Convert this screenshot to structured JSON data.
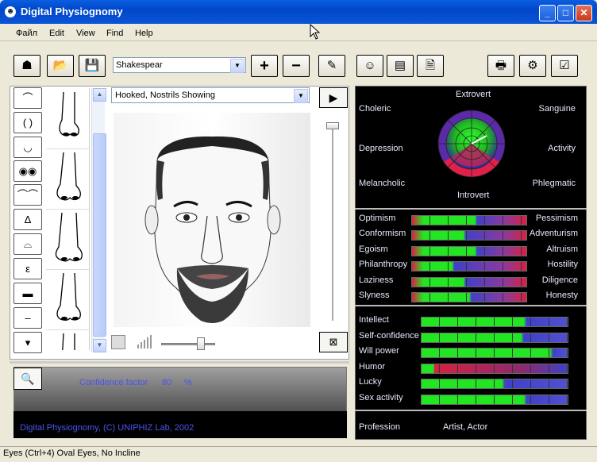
{
  "window": {
    "title": "Digital Physiognomy"
  },
  "menu": [
    "Файл",
    "Edit",
    "View",
    "Find",
    "Help"
  ],
  "toolbar": {
    "preset": "Shakespear"
  },
  "nose_panel": {
    "selected": "Hooked, Nostrils Showing"
  },
  "confidence": {
    "label": "Confidence factor",
    "value": "80",
    "unit": "%"
  },
  "copyright": "Digital Physiognomy, (C) UNIPHIZ Lab, 2002",
  "temperament": {
    "top": "Extrovert",
    "bottom": "Introvert",
    "left": [
      "Choleric",
      "Depression",
      "Melancholic"
    ],
    "right": [
      "Sanguine",
      "Activity",
      "Phlegmatic"
    ]
  },
  "traits": [
    {
      "left": "Optimism",
      "right": "Pessimism",
      "value": 0.55
    },
    {
      "left": "Conformism",
      "right": "Adventurism",
      "value": 0.45
    },
    {
      "left": "Egoism",
      "right": "Altruism",
      "value": 0.55
    },
    {
      "left": "Philanthropy",
      "right": "Hostility",
      "value": 0.35
    },
    {
      "left": "Laziness",
      "right": "Diligence",
      "value": 0.45
    },
    {
      "left": "Slyness",
      "right": "Honesty",
      "value": 0.5
    }
  ],
  "abilities": [
    {
      "label": "Intellect",
      "value": 0.7
    },
    {
      "label": "Self-confidence",
      "value": 0.68
    },
    {
      "label": "Will power",
      "value": 0.88
    },
    {
      "label": "Humor",
      "value": 0.08
    },
    {
      "label": "Lucky",
      "value": 0.55
    },
    {
      "label": "Sex activity",
      "value": 0.7
    }
  ],
  "profession": {
    "label": "Profession",
    "value": "Artist, Actor"
  },
  "status": "Eyes (Ctrl+4) Oval Eyes, No Incline",
  "colors": {
    "titlebar": "#0a5ee0",
    "label_blue": "#4a55f0",
    "bar_green": "#22e622",
    "bar_red": "#d92040",
    "bar_blue": "#4040c8"
  }
}
